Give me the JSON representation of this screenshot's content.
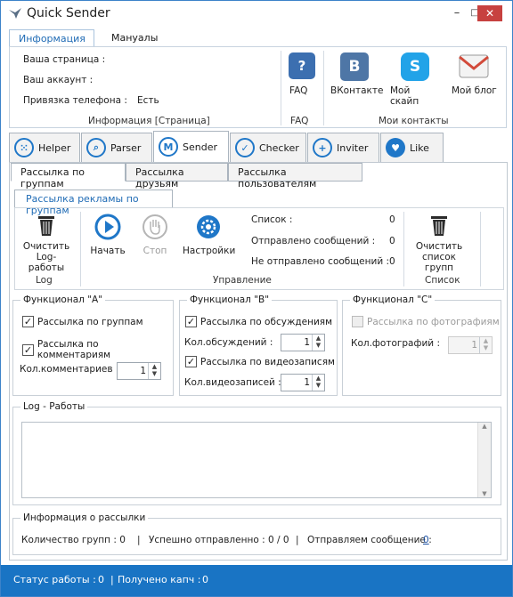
{
  "window": {
    "title": "Quick Sender",
    "minimize": "–",
    "maximize": "□",
    "close": "✕"
  },
  "ribbon": {
    "tabs": [
      "Информация",
      "Мануалы"
    ],
    "info": {
      "page_label": "Ваша страница :",
      "account_label": "Ваш аккаунт  :",
      "phone_label": "Привязка телефона :",
      "phone_value": "Есть",
      "caption": "Информация [Страница]"
    },
    "faq": {
      "label": "FAQ",
      "caption": "FAQ"
    },
    "contacts": {
      "items": [
        {
          "label": "ВКонтакте",
          "icon": "vk-icon",
          "color": "#4e76a6"
        },
        {
          "label": "Мой скайп",
          "icon": "skype-icon",
          "color": "#22a3e8"
        },
        {
          "label": "Мой блог",
          "icon": "mail-icon",
          "color": "#d24a3a"
        }
      ],
      "caption": "Мои контакты"
    }
  },
  "main_tabs": [
    {
      "label": "Helper",
      "icon": "dots-icon"
    },
    {
      "label": "Parser",
      "icon": "search-icon"
    },
    {
      "label": "Sender",
      "icon": "m-icon"
    },
    {
      "label": "Checker",
      "icon": "check-icon"
    },
    {
      "label": "Inviter",
      "icon": "plus-icon"
    },
    {
      "label": "Like",
      "icon": "heart-icon"
    }
  ],
  "sub_tabs": [
    "Рассылка по группам",
    "Рассылка друзьям",
    "Рассылка пользователям"
  ],
  "toolbar": {
    "tab": "Рассылка рекламы по группам",
    "clear_log": "Очистить Log- работы",
    "log_caption": "Log",
    "start": "Начать",
    "stop": "Стоп",
    "settings": "Настройки",
    "control_caption": "Управление",
    "stats": [
      {
        "label": "Список :",
        "value": "0"
      },
      {
        "label": "Отправлено сообщений :",
        "value": "0"
      },
      {
        "label": "Не отправлено сообщений :",
        "value": "0"
      }
    ],
    "clear_list": "Очистить список групп",
    "list_caption": "Список"
  },
  "func_a": {
    "title": "Функционал \"A\"",
    "group_send": "Рассылка по группам",
    "comment_send": "Рассылка по комментариям",
    "comments_count_label": "Кол.комментариев :",
    "comments_count": "1"
  },
  "func_b": {
    "title": "Функционал \"B\"",
    "discussion_send": "Рассылка по обсуждениям",
    "discussions_count_label": "Кол.обсуждений :",
    "discussions_count": "1",
    "video_send": "Рассылка по видеозаписям",
    "videos_count_label": "Кол.видеозаписей :",
    "videos_count": "1"
  },
  "func_c": {
    "title": "Функционал \"C\"",
    "photo_send": "Рассылка по фотографиям",
    "photos_count_label": "Кол.фотографий :",
    "photos_count": "1"
  },
  "log": {
    "title": "Log - Работы"
  },
  "mailing_info": {
    "title": "Информация о рассылки",
    "groups_label": "Количество групп : 0",
    "sent_label": "Успешно отправленно : 0 / 0",
    "sending_label": "Отправляем сообщение :",
    "sending_value": "0",
    "sep": "|"
  },
  "status": {
    "work_label": "Статус работы :",
    "work_value": "0",
    "captcha_label": "Получено капч :",
    "captcha_value": "0",
    "sep": "|"
  }
}
